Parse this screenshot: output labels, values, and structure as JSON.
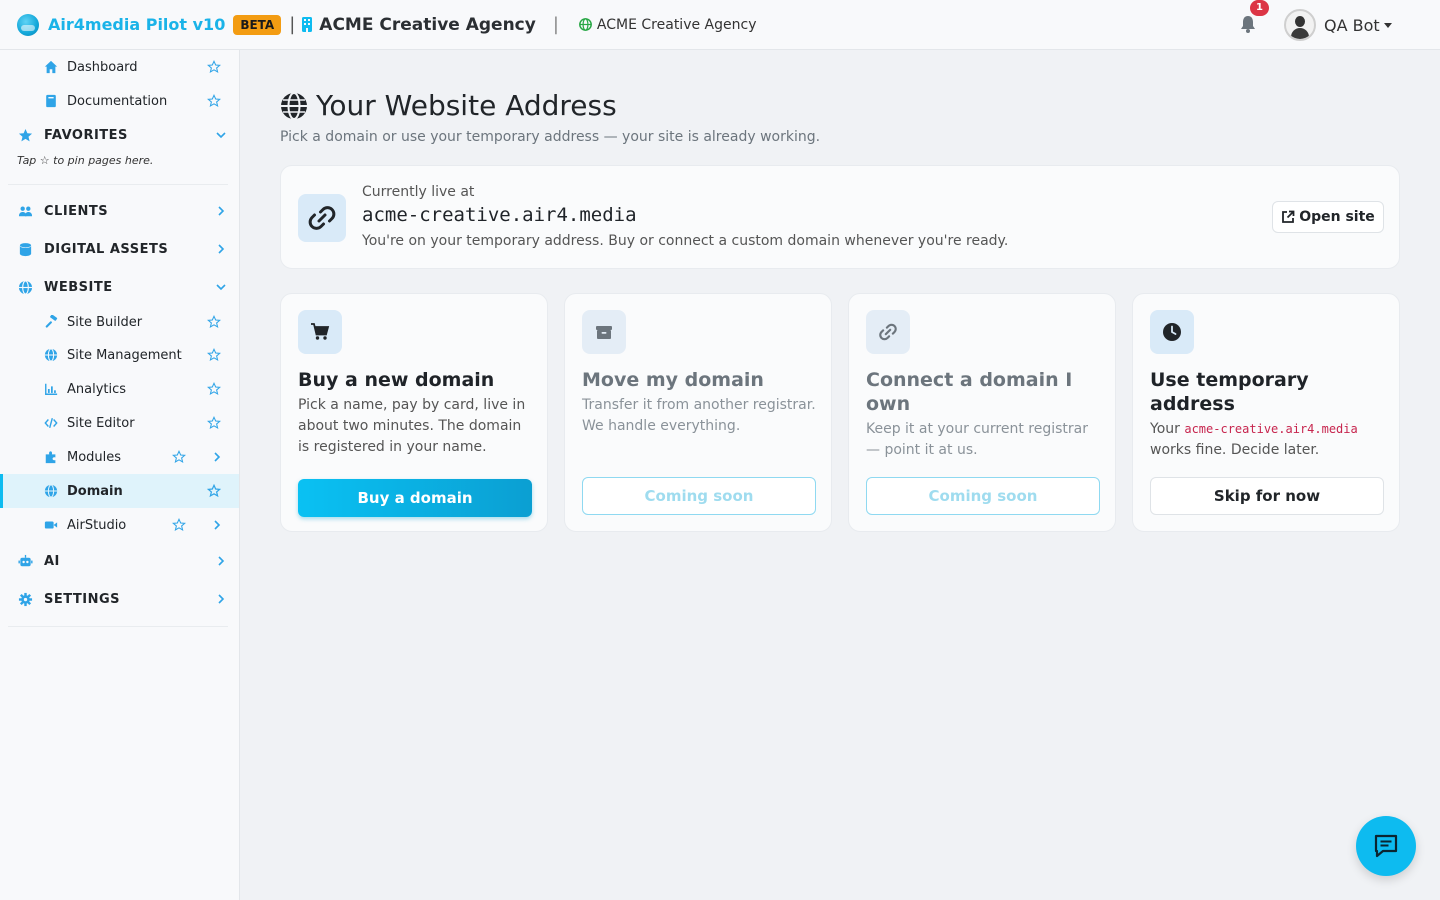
{
  "topbar": {
    "brand_name": "Air4media Pilot v10",
    "beta_badge": "BETA",
    "separator": "|",
    "agency_name": "ACME Creative Agency",
    "separator2": "|",
    "site_link": "ACME Creative Agency",
    "notification_count": "1",
    "user_name": "QA Bot",
    "brand_color": "#1ab3e8"
  },
  "sidebar": {
    "top_items": [
      {
        "label": "Dashboard",
        "icon": "home-icon"
      },
      {
        "label": "Documentation",
        "icon": "book-icon"
      }
    ],
    "favorites": {
      "label": "FAVORITES",
      "hint": "Tap ☆ to pin pages here."
    },
    "sections": {
      "clients": "CLIENTS",
      "digital_assets": "DIGITAL ASSETS",
      "website": "WEBSITE",
      "ai": "AI",
      "settings": "SETTINGS"
    },
    "website_items": [
      {
        "label": "Site Builder",
        "icon": "hammer-icon"
      },
      {
        "label": "Site Management",
        "icon": "globe-icon"
      },
      {
        "label": "Analytics",
        "icon": "chart-icon"
      },
      {
        "label": "Site Editor",
        "icon": "code-icon"
      },
      {
        "label": "Modules",
        "icon": "puzzle-icon"
      },
      {
        "label": "Domain",
        "icon": "globe-icon",
        "active": true
      },
      {
        "label": "AirStudio",
        "icon": "video-icon"
      }
    ],
    "accent_color": "#0dbbf0"
  },
  "main": {
    "title": "Your Website Address",
    "subtitle": "Pick a domain or use your temporary address — your site is already working.",
    "live": {
      "label": "Currently live at",
      "domain": "acme-creative.air4.media",
      "note": "You're on your temporary address. Buy or connect a custom domain whenever you're ready.",
      "open_button": "Open site"
    },
    "options": [
      {
        "title": "Buy a new domain",
        "desc": "Pick a name, pay by card, live in about two minutes. The domain is registered in your name.",
        "button": "Buy a domain",
        "icon": "cart-icon"
      },
      {
        "title": "Move my domain",
        "desc": "Transfer it from another registrar. We handle everything.",
        "button": "Coming soon",
        "icon": "box-icon"
      },
      {
        "title": "Connect a domain I own",
        "desc": "Keep it at your current registrar — point it at us.",
        "button": "Coming soon",
        "icon": "link-icon"
      },
      {
        "title": "Use temporary address",
        "desc_prefix": "Your",
        "desc_code": "acme-creative.air4.media",
        "desc_suffix": "works fine. Decide later.",
        "button": "Skip for now",
        "icon": "clock-icon"
      }
    ]
  }
}
